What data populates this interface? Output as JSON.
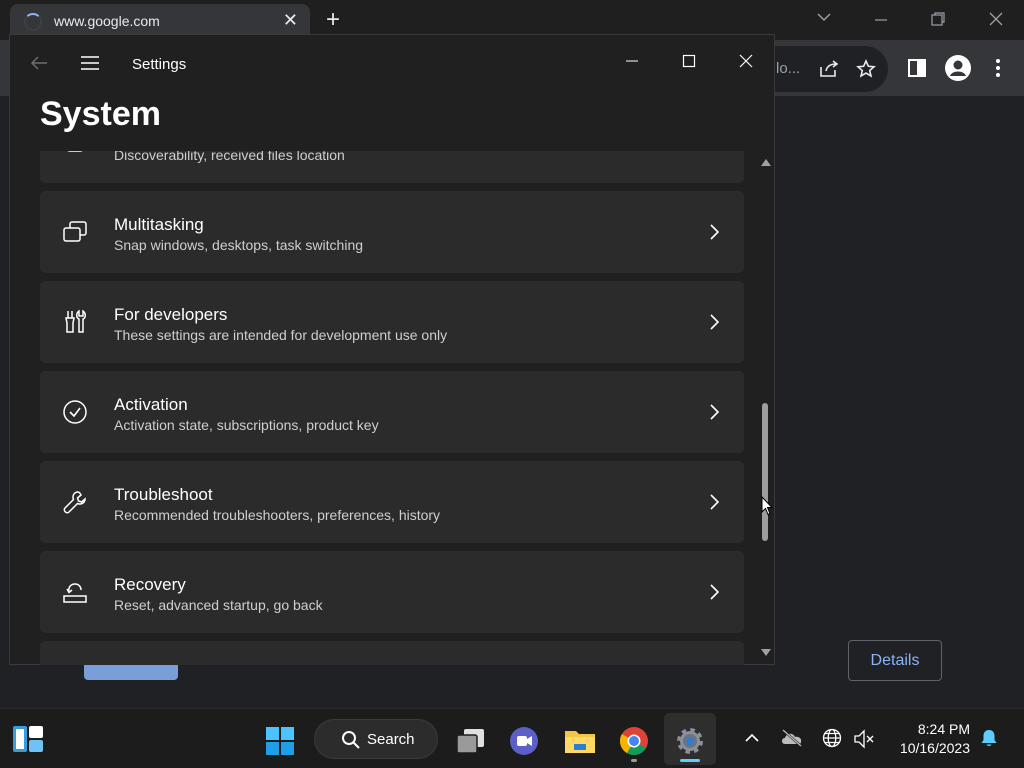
{
  "browser": {
    "tab_title": "www.google.com",
    "tab_close": "✕",
    "new_tab": "+",
    "omnibox_text": "lo...",
    "details_label": "Details",
    "colors": {
      "background": "#202124",
      "toolbar": "#35363a",
      "link": "#8ab4f8"
    }
  },
  "settings": {
    "app_title": "Settings",
    "page_title": "System",
    "items": [
      {
        "title": "",
        "description": "Discoverability, received files location",
        "icon": "nearby-sharing-icon"
      },
      {
        "title": "Multitasking",
        "description": "Snap windows, desktops, task switching",
        "icon": "multitasking-icon"
      },
      {
        "title": "For developers",
        "description": "These settings are intended for development use only",
        "icon": "developers-icon"
      },
      {
        "title": "Activation",
        "description": "Activation state, subscriptions, product key",
        "icon": "activation-icon"
      },
      {
        "title": "Troubleshoot",
        "description": "Recommended troubleshooters, preferences, history",
        "icon": "troubleshoot-icon"
      },
      {
        "title": "Recovery",
        "description": "Reset, advanced startup, go back",
        "icon": "recovery-icon"
      }
    ],
    "colors": {
      "window": "#202020",
      "card": "#2b2b2b",
      "subtext": "#cfcfcf"
    }
  },
  "taskbar": {
    "search_label": "Search",
    "time": "8:24 PM",
    "date": "10/16/2023",
    "accent": "#60cdff",
    "apps": [
      "start-icon",
      "search-icon",
      "task-view-icon",
      "teams-icon",
      "file-explorer-icon",
      "chrome-icon",
      "settings-icon"
    ],
    "tray": [
      "show-hidden-icons-icon",
      "onedrive-icon",
      "network-icon",
      "volume-muted-icon",
      "notification-bell-icon"
    ]
  }
}
